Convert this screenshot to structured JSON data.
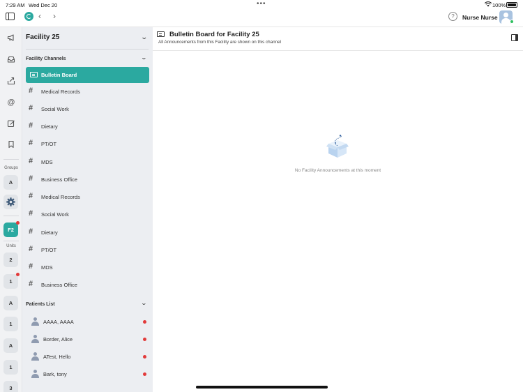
{
  "status_bar": {
    "time": "7:29 AM",
    "date": "Wed Dec 20",
    "battery": "100%"
  },
  "top_nav": {
    "user_name": "Nurse Nurse",
    "help_symbol": "?",
    "back_glyph": "‹",
    "forward_glyph": "›"
  },
  "rail": {
    "icons": [
      "megaphone-icon",
      "inbox-icon",
      "outbox-icon",
      "at-mention-icon",
      "compose-icon",
      "bookmark-icon"
    ],
    "groups_label": "Groups",
    "group_badges": [
      "A"
    ],
    "facility_badge": "F2",
    "units_label": "Units",
    "unit_badges": [
      {
        "label": "2",
        "alert": false
      },
      {
        "label": "1",
        "alert": true
      },
      {
        "label": "A",
        "alert": false
      },
      {
        "label": "1",
        "alert": false
      },
      {
        "label": "A",
        "alert": false
      },
      {
        "label": "1",
        "alert": false
      },
      {
        "label": "3",
        "alert": false
      }
    ]
  },
  "channels": {
    "facility_title": "Facility 25",
    "facility_channels_heading": "Facility Channels",
    "items": [
      {
        "label": "Bulletin Board",
        "active": true
      },
      {
        "label": "Medical Records",
        "active": false
      },
      {
        "label": "Social Work",
        "active": false
      },
      {
        "label": "Dietary",
        "active": false
      },
      {
        "label": "PT/OT",
        "active": false
      },
      {
        "label": "MDS",
        "active": false
      },
      {
        "label": "Business Office",
        "active": false
      },
      {
        "label": "Medical Records",
        "active": false
      },
      {
        "label": "Social Work",
        "active": false
      },
      {
        "label": "Dietary",
        "active": false
      },
      {
        "label": "PT/OT",
        "active": false
      },
      {
        "label": "MDS",
        "active": false
      },
      {
        "label": "Business Office",
        "active": false
      }
    ],
    "patients_heading": "Patients List",
    "patients": [
      {
        "name": "AAAA, AAAA",
        "unread": true
      },
      {
        "name": "Border, Alice",
        "unread": true
      },
      {
        "name": "ATest, Hello",
        "unread": true
      },
      {
        "name": "Bark, tony",
        "unread": true
      }
    ]
  },
  "main": {
    "title": "Bulletin Board for Facility 25",
    "subtitle": "All Announcements from this Facility are shown on this channel",
    "empty_message": "No Facility Announcements at this moment"
  },
  "colors": {
    "accent": "#2ba9a0",
    "alert": "#e23a3a",
    "panel_bg": "#eceef2",
    "rail_bg": "#f1f2f4"
  }
}
